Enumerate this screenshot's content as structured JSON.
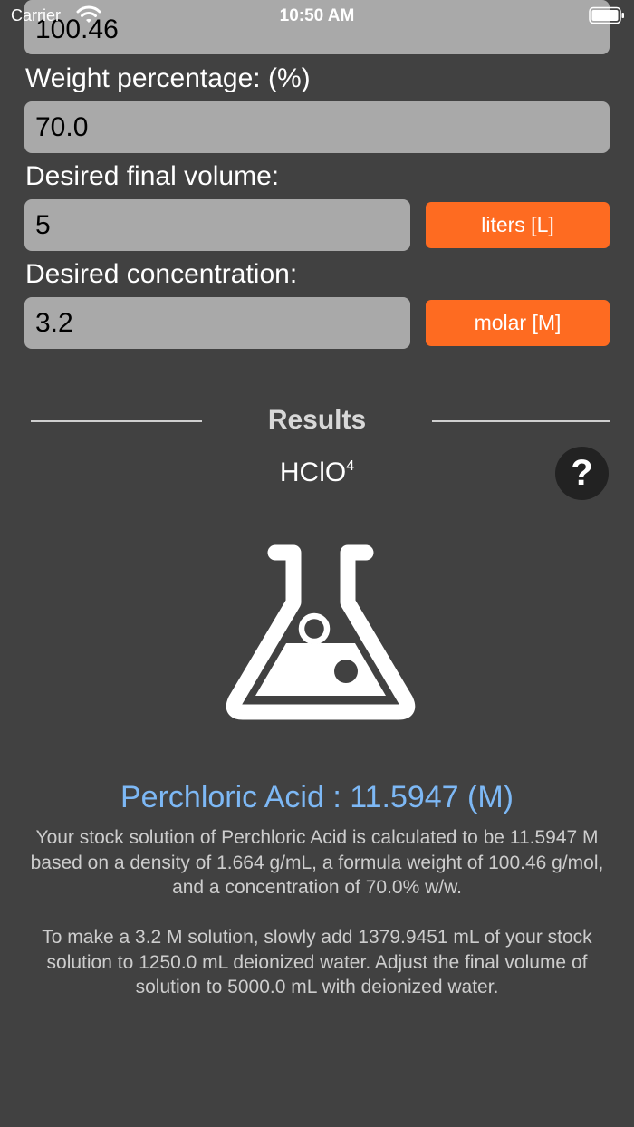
{
  "status_bar": {
    "carrier": "Carrier",
    "time": "10:50 AM"
  },
  "form": {
    "formula_weight_value": "100.46",
    "weight_percentage_label": "Weight percentage:  (%)",
    "weight_percentage_value": "70.0",
    "final_volume_label": "Desired final volume:",
    "final_volume_value": "5",
    "volume_unit": "liters [L]",
    "concentration_label": "Desired concentration:",
    "concentration_value": "3.2",
    "concentration_unit": "molar [M]"
  },
  "results": {
    "title": "Results",
    "formula_base": "HClO",
    "formula_sub": "4",
    "help_label": "?",
    "headline": "Perchloric Acid : 11.5947 (M)",
    "paragraph1": "Your stock solution of Perchloric Acid is calculated to be 11.5947 M based on a density of 1.664 g/mL, a formula weight of 100.46 g/mol, and a concentration of 70.0% w/w.",
    "paragraph2": "To make a 3.2 M solution, slowly add 1379.9451 mL of your stock solution to 1250.0 mL deionized water. Adjust the final volume of solution to 5000.0 mL with deionized water."
  },
  "colors": {
    "background": "#414141",
    "field": "#a9a9a9",
    "accent_button": "#fe6b21",
    "result_text": "#7db8f5"
  },
  "icons": [
    "wifi-icon",
    "battery-icon",
    "help-icon",
    "flask-icon"
  ]
}
